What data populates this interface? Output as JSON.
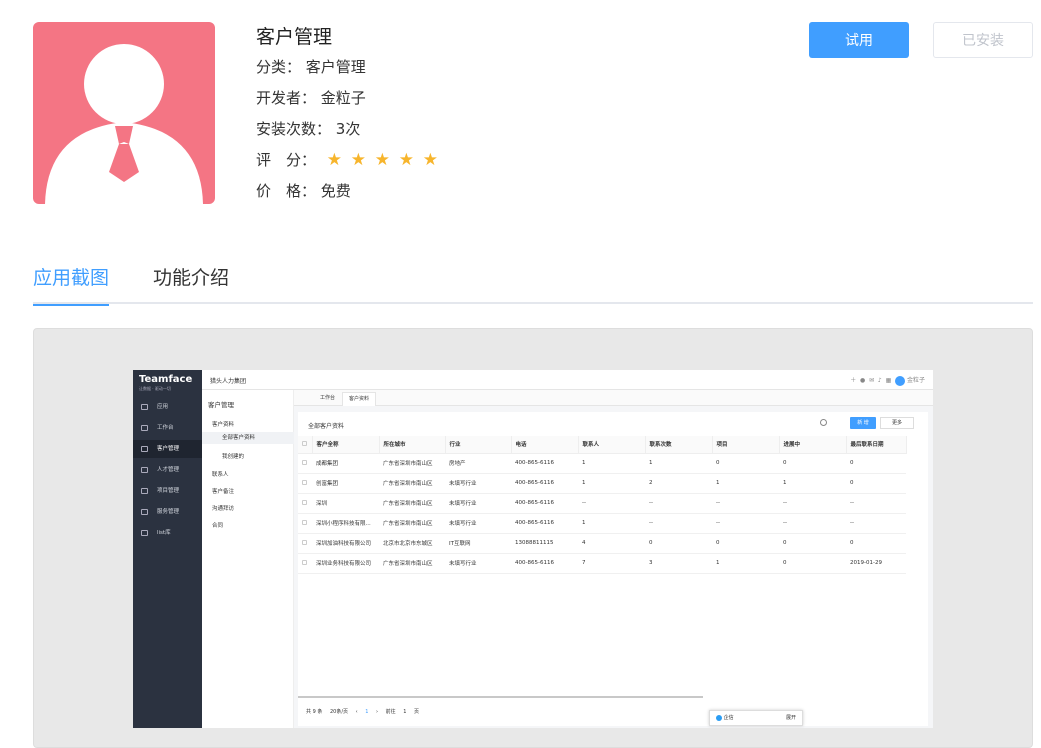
{
  "app": {
    "name": "客户管理",
    "category_label": "分类：",
    "category": "客户管理",
    "developer_label": "开发者：",
    "developer": "金粒子",
    "installs_label": "安装次数：",
    "installs": "3次",
    "rating_label": "评　分：",
    "rating": 5,
    "price_label": "价　格：",
    "price": "免费",
    "icon": "user-avatar-icon",
    "icon_color": "#f47584"
  },
  "buttons": {
    "try": "试用",
    "installed": "已安装"
  },
  "tabs": [
    {
      "label": "应用截图",
      "active": true
    },
    {
      "label": "功能介绍",
      "active": false
    }
  ],
  "accent_color": "#409eff",
  "screenshot": {
    "brand": "Teamface",
    "brand_sub": "让数据 · 驱动一切",
    "org": "猎头人力集团",
    "user": "金粒子",
    "side_items": [
      "应用",
      "工作台",
      "客户管理",
      "人才管理",
      "项目管理",
      "服务管理",
      "list库"
    ],
    "submenu_title": "客户管理",
    "submenu": [
      "客户资料",
      "全部客户资料",
      "我创建的",
      "联系人",
      "客户备注",
      "沟通拜访",
      "合同"
    ],
    "content_tabs": [
      "工作台",
      "客户资料"
    ],
    "panel_title": "全部客户资料",
    "new_button": "新 增",
    "more_button": "更多",
    "columns": [
      "客户全称",
      "所在城市",
      "行业",
      "电话",
      "联系人",
      "联系次数",
      "项目",
      "进展中",
      "最后联系日期"
    ],
    "rows": [
      [
        "成都集团",
        "广东省深圳市南山区",
        "房地产",
        "400-865-6116",
        "1",
        "1",
        "0",
        "0",
        "0"
      ],
      [
        "创富集团",
        "广东省深圳市南山区",
        "未填写行业",
        "400-865-6116",
        "1",
        "2",
        "1",
        "1",
        "0"
      ],
      [
        "深圳",
        "广东省深圳市南山区",
        "未填写行业",
        "400-865-6116",
        "--",
        "--",
        "--",
        "--",
        "--"
      ],
      [
        "深圳小程序科技有限...",
        "广东省深圳市南山区",
        "未填写行业",
        "400-865-6116",
        "1",
        "--",
        "--",
        "--",
        "--"
      ],
      [
        "深圳加油科技有限公司",
        "北京市北京市东城区",
        "IT互联网",
        "13088811115",
        "4",
        "0",
        "0",
        "0",
        "0"
      ],
      [
        "深圳业务科技有限公司",
        "广东省深圳市南山区",
        "未填写行业",
        "400-865-6116",
        "7",
        "3",
        "1",
        "0",
        "2019-01-29"
      ]
    ],
    "pager": {
      "total": "共 9 条",
      "per_page": "20条/页",
      "page": "1",
      "goto": "前往",
      "goto_page": "1",
      "page_unit": "页"
    },
    "bubble": {
      "label": "企信",
      "action": "展开"
    }
  }
}
